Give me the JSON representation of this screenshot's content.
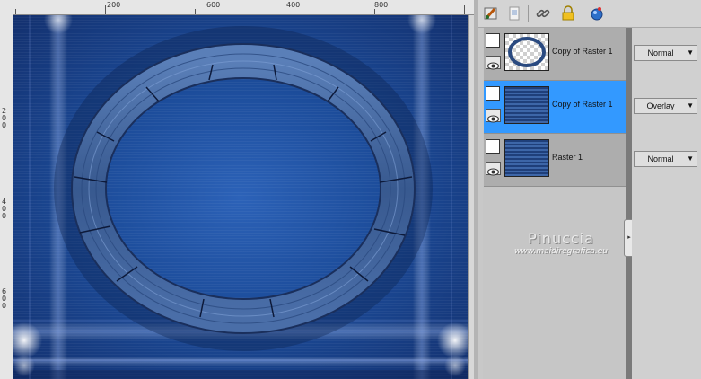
{
  "ruler": {
    "top_labels": [
      "200",
      "400",
      "600",
      "800"
    ],
    "left_labels": [
      "2",
      "0",
      "0",
      "4",
      "0",
      "0",
      "6",
      "0",
      "0"
    ]
  },
  "toolbar": {
    "icons": [
      "paint-brush-icon",
      "document-icon",
      "link-icon",
      "lock-icon",
      "sphere-icon"
    ]
  },
  "layers": [
    {
      "name": "Copy of Raster 1",
      "blend": "Normal",
      "selected": false,
      "thumb": "oval-frame"
    },
    {
      "name": "Copy of Raster 1",
      "blend": "Overlay",
      "selected": true,
      "thumb": "blue-stripes"
    },
    {
      "name": "Raster 1",
      "blend": "Normal",
      "selected": false,
      "thumb": "blue-stripes"
    }
  ],
  "watermark": {
    "title": "Pinuccia",
    "url": "www.maidiregrafica.eu"
  },
  "colors": {
    "selected_row": "#3399ff",
    "canvas_blue": "#1c4c9a"
  }
}
